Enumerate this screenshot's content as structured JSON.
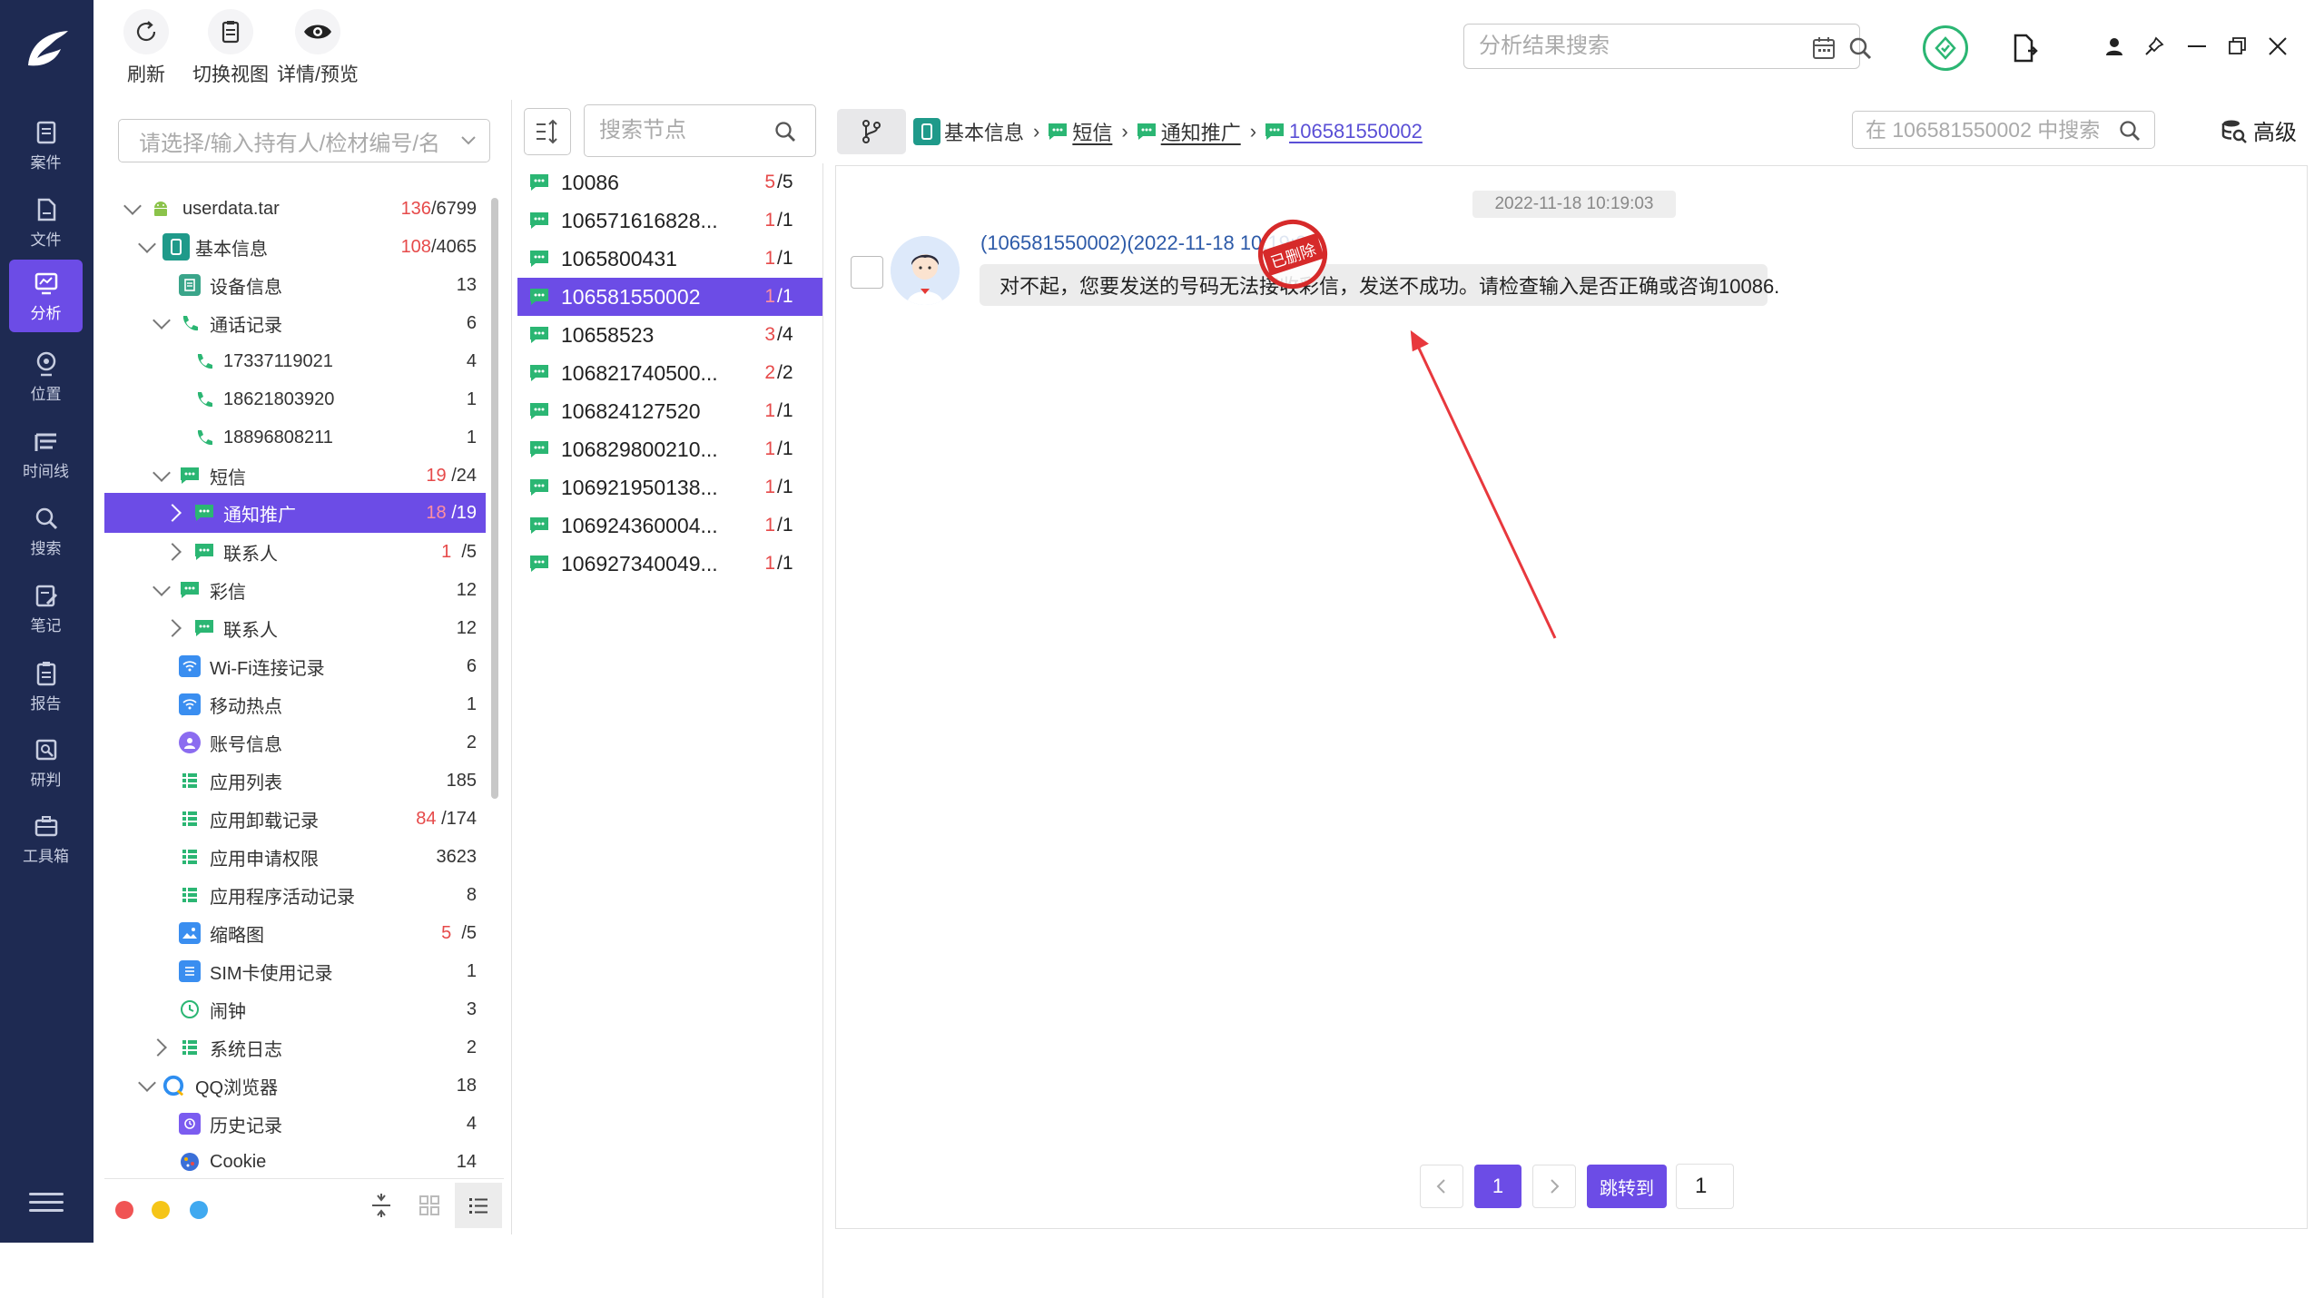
{
  "toolbar": {
    "refresh_label": "刷新",
    "switch_view_label": "切换视图",
    "detail_label": "详情/预览"
  },
  "top_search": {
    "placeholder": "分析结果搜索"
  },
  "nav": {
    "items": [
      {
        "label": "案件",
        "icon": "case-icon"
      },
      {
        "label": "文件",
        "icon": "file-icon"
      },
      {
        "label": "分析",
        "icon": "analysis-icon",
        "active": true
      },
      {
        "label": "位置",
        "icon": "location-icon"
      },
      {
        "label": "时间线",
        "icon": "timeline-icon"
      },
      {
        "label": "搜索",
        "icon": "search-icon"
      },
      {
        "label": "笔记",
        "icon": "note-icon"
      },
      {
        "label": "报告",
        "icon": "report-icon"
      },
      {
        "label": "研判",
        "icon": "judge-icon"
      },
      {
        "label": "工具箱",
        "icon": "toolbox-icon"
      }
    ]
  },
  "left_panel": {
    "select_placeholder": "请选择/输入持有人/检材编号/名",
    "tree": [
      {
        "label": "userdata.tar",
        "red": "136",
        "total": "/6799"
      },
      {
        "label": "基本信息",
        "red": "108",
        "total": "/4065"
      },
      {
        "label": "设备信息",
        "red": "",
        "total": "13"
      },
      {
        "label": "通话记录",
        "red": "",
        "total": "6"
      },
      {
        "label": "17337119021",
        "red": "",
        "total": "4"
      },
      {
        "label": "18621803920",
        "red": "",
        "total": "1"
      },
      {
        "label": "18896808211",
        "red": "",
        "total": "1"
      },
      {
        "label": "短信",
        "red": "19",
        "total": "/24"
      },
      {
        "label": "通知推广",
        "red": "18",
        "total": "/19"
      },
      {
        "label": "联系人",
        "red": "1",
        "total": "/5"
      },
      {
        "label": "彩信",
        "red": "",
        "total": "12"
      },
      {
        "label": "联系人",
        "red": "",
        "total": "12"
      },
      {
        "label": "Wi-Fi连接记录",
        "red": "",
        "total": "6"
      },
      {
        "label": "移动热点",
        "red": "",
        "total": "1"
      },
      {
        "label": "账号信息",
        "red": "",
        "total": "2"
      },
      {
        "label": "应用列表",
        "red": "",
        "total": "185"
      },
      {
        "label": "应用卸载记录",
        "red": "84",
        "total": "/174"
      },
      {
        "label": "应用申请权限",
        "red": "",
        "total": "3623"
      },
      {
        "label": "应用程序活动记录",
        "red": "",
        "total": "8"
      },
      {
        "label": "缩略图",
        "red": "5",
        "total": "/5"
      },
      {
        "label": "SIM卡使用记录",
        "red": "",
        "total": "1"
      },
      {
        "label": "闹钟",
        "red": "",
        "total": "3"
      },
      {
        "label": "系统日志",
        "red": "",
        "total": "2"
      },
      {
        "label": "QQ浏览器",
        "red": "",
        "total": "18"
      },
      {
        "label": "历史记录",
        "red": "",
        "total": "4"
      },
      {
        "label": "Cookie",
        "red": "",
        "total": "14"
      }
    ]
  },
  "mid_panel": {
    "search_placeholder": "搜索节点",
    "items": [
      {
        "label": "10086",
        "red": "5",
        "total": "/5"
      },
      {
        "label": "106571616828...",
        "red": "1",
        "total": "/1"
      },
      {
        "label": "1065800431",
        "red": "1",
        "total": "/1"
      },
      {
        "label": "106581550002",
        "red": "1",
        "total": "/1"
      },
      {
        "label": "10658523",
        "red": "3",
        "total": "/4"
      },
      {
        "label": "106821740500...",
        "red": "2",
        "total": "/2"
      },
      {
        "label": "106824127520",
        "red": "1",
        "total": "/1"
      },
      {
        "label": "106829800210...",
        "red": "1",
        "total": "/1"
      },
      {
        "label": "106921950138...",
        "red": "1",
        "total": "/1"
      },
      {
        "label": "106924360004...",
        "red": "1",
        "total": "/1"
      },
      {
        "label": "106927340049...",
        "red": "1",
        "total": "/1"
      }
    ]
  },
  "breadcrumb": {
    "items": [
      "基本信息",
      "短信",
      "通知推广"
    ],
    "current": "106581550002"
  },
  "right_search": {
    "placeholder": "在 106581550002 中搜索"
  },
  "advanced_label": "高级",
  "message": {
    "date": "2022-11-18 10:19:03",
    "header": "(106581550002)(2022-11-18 10:19:03)",
    "text": "对不起，您要发送的号码无法接收彩信，发送不成功。请检查输入是否正确或咨询10086.",
    "stamp": "已删除"
  },
  "pager": {
    "current_page": "1",
    "jump_label": "跳转到",
    "jump_value": "1"
  },
  "colors": {
    "nav_bg": "#1e2a52",
    "accent": "#6c4ce6",
    "sms_green": "#2bb673",
    "count_red": "#e64a4a"
  }
}
